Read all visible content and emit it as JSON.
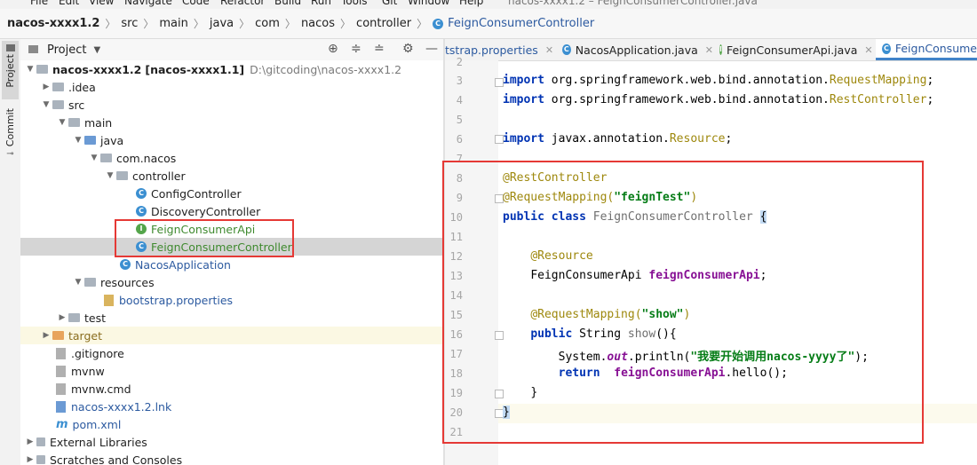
{
  "menu": [
    "File",
    "Edit",
    "View",
    "Navigate",
    "Code",
    "Refactor",
    "Build",
    "Run",
    "Tools",
    "Git",
    "Window",
    "Help"
  ],
  "window_title": "nacos-xxxx1.2 – FeignConsumerController.java",
  "breadcrumb": [
    "nacos-xxxx1.2",
    "src",
    "main",
    "java",
    "com",
    "nacos",
    "controller",
    "FeignConsumerController"
  ],
  "sidebar": {
    "project_tab": "Project",
    "commit_tab": "Commit"
  },
  "project_panel": {
    "title": "Project"
  },
  "tree": [
    {
      "label": "nacos-xxxx1.2",
      "extra": "[nacos-xxxx1.1]",
      "path": "D:\\gitcoding\\nacos-xxxx1.2"
    },
    {
      "label": ".idea"
    },
    {
      "label": "src"
    },
    {
      "label": "main"
    },
    {
      "label": "java"
    },
    {
      "label": "com.nacos"
    },
    {
      "label": "controller"
    },
    {
      "label": "ConfigController"
    },
    {
      "label": "DiscoveryController"
    },
    {
      "label": "FeignConsumerApi"
    },
    {
      "label": "FeignConsumerController"
    },
    {
      "label": "NacosApplication"
    },
    {
      "label": "resources"
    },
    {
      "label": "bootstrap.properties"
    },
    {
      "label": "test"
    },
    {
      "label": "target"
    },
    {
      "label": ".gitignore"
    },
    {
      "label": "mvnw"
    },
    {
      "label": "mvnw.cmd"
    },
    {
      "label": "nacos-xxxx1.2.lnk"
    },
    {
      "label": "pom.xml"
    },
    {
      "label": "External Libraries"
    },
    {
      "label": "Scratches and Consoles"
    }
  ],
  "tabs": [
    {
      "label": "tstrap.properties"
    },
    {
      "label": "NacosApplication.java"
    },
    {
      "label": "FeignConsumerApi.java"
    },
    {
      "label": "FeignConsume"
    }
  ],
  "code": {
    "line_numbers": [
      "2",
      "3",
      "4",
      "5",
      "6",
      "7",
      "8",
      "9",
      "10",
      "11",
      "12",
      "13",
      "14",
      "15",
      "16",
      "17",
      "18",
      "19",
      "20",
      "21"
    ],
    "l3_kw": "import",
    "l3_pkg": "org.springframework.web.bind.annotation.",
    "l3_cls": "RequestMapping",
    "l3_end": ";",
    "l4_kw": "import",
    "l4_pkg": "org.springframework.web.bind.annotation.",
    "l4_cls": "RestController",
    "l4_end": ";",
    "l6_kw": "import",
    "l6_pkg": "javax.annotation.",
    "l6_cls": "Resource",
    "l6_end": ";",
    "l8": "@RestController",
    "l9_ann": "@RequestMapping(",
    "l9_str": "\"feignTest\"",
    "l9_end": ")",
    "l10_kw": "public class",
    "l10_name": "FeignConsumerController",
    "l10_brace": "{",
    "l12": "@Resource",
    "l13_type": "FeignConsumerApi",
    "l13_field": "feignConsumerApi",
    "l13_end": ";",
    "l15_ann": "@RequestMapping(",
    "l15_str": "\"show\"",
    "l15_end": ")",
    "l16_kw": "public",
    "l16_type": "String",
    "l16_meth": "show",
    "l16_end": "(){",
    "l17_sys": "System.",
    "l17_out": "out",
    "l17_print": ".println(",
    "l17_str": "\"我要开始调用nacos-yyyy了\"",
    "l17_end": ");",
    "l18_kw": "return",
    "l18_field": "feignConsumerApi",
    "l18_end": ".hello();",
    "l19": "}",
    "l20": "}"
  }
}
